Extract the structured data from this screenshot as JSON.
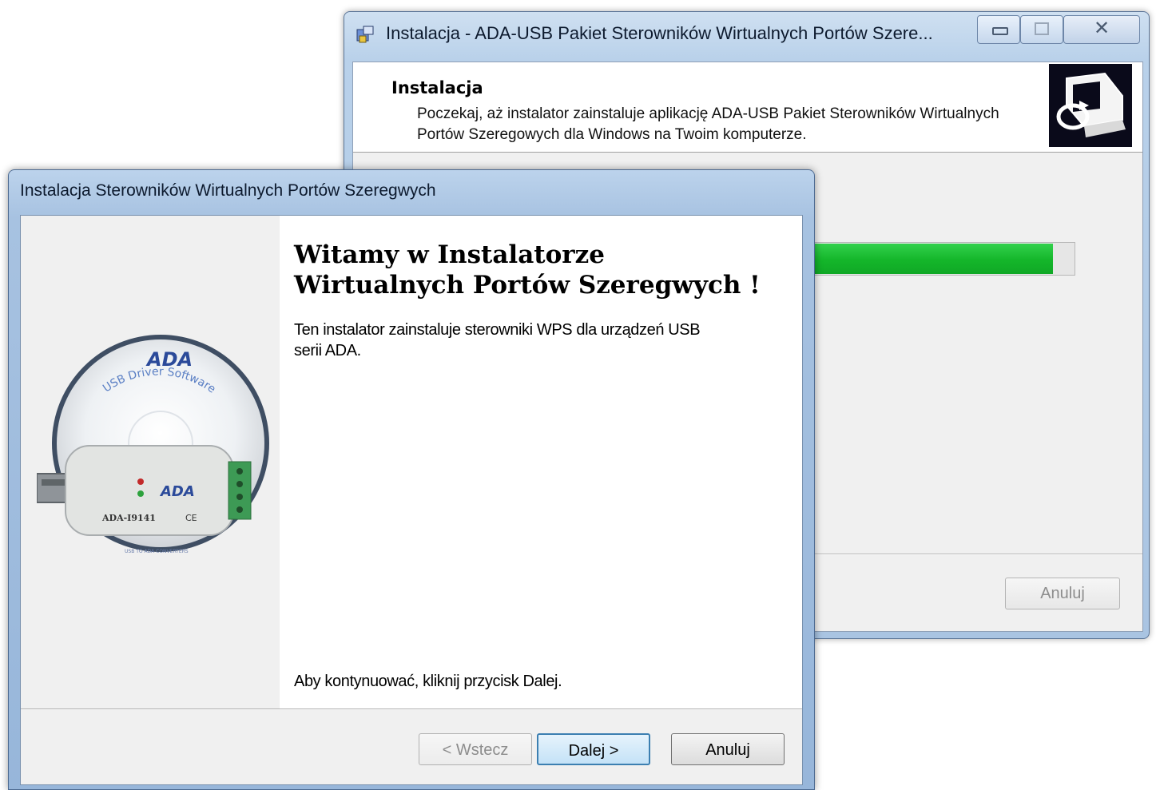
{
  "background_window": {
    "title": "Instalacja - ADA-USB Pakiet Sterowników Wirtualnych Portów Szere...",
    "header_title": "Instalacja",
    "header_description": "Poczekaj, aż instalator zainstaluje aplikację ADA-USB Pakiet Sterowników Wirtualnych Portów Szeregowych dla Windows na Twoim komputerze.",
    "progress_fraction": 0.97,
    "cancel_label": "Anuluj",
    "caption_close": "✕"
  },
  "foreground_window": {
    "title": "Instalacja Sterowników Wirtualnych Portów Szeregwych",
    "welcome_line1": "Witamy w Instalatorze",
    "welcome_line2": "Wirtualnych Portów Szeregwych !",
    "description": "Ten instalator zainstaluje sterowniki WPS dla urządzeń USB serii ADA.",
    "continue_text": "Aby kontynuować, kliknij przycisk Dalej.",
    "buttons": {
      "back": "< Wstecz",
      "next": "Dalej >",
      "cancel": "Anuluj"
    },
    "cd_image": {
      "brand": "ADA",
      "arc_text": "USB Driver Software",
      "device_model": "ADA-I9141",
      "device_brand": "ADA",
      "ce_mark": "CE",
      "bottom_text": "USB TO ADA CONVERTERS"
    }
  },
  "colors": {
    "progress_green": "#14b62a",
    "next_border": "#3c7fb1"
  }
}
